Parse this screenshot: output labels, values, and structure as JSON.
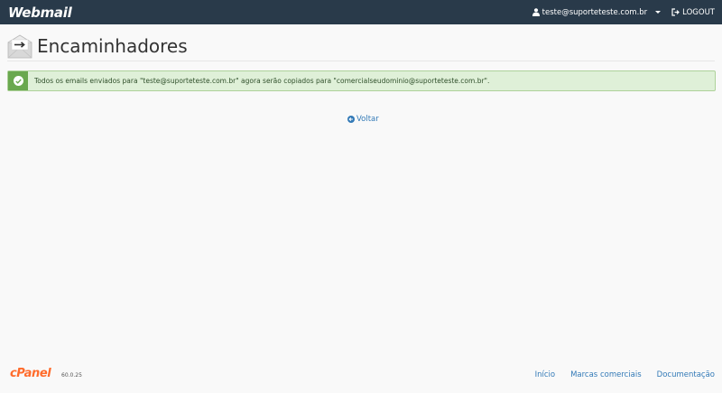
{
  "topbar": {
    "brand": "Webmail",
    "user_email": "teste@suporteteste.com.br",
    "logout_label": "LOGOUT"
  },
  "header": {
    "title": "Encaminhadores"
  },
  "alert": {
    "status": "success",
    "message": "Todos os emails enviados para \"teste@suporteteste.com.br\" agora serão copiados para \"comercialseudominio@suporteteste.com.br\"."
  },
  "back_link": {
    "label": "Voltar"
  },
  "footer": {
    "logo": "cPanel",
    "version": "60.0.25",
    "links": [
      "Início",
      "Marcas comerciais",
      "Documentação"
    ]
  },
  "colors": {
    "topbar": "#293a4a",
    "accent": "#337ab7",
    "success": "#6aa84f",
    "cpanel_orange": "#ff6c2c"
  }
}
